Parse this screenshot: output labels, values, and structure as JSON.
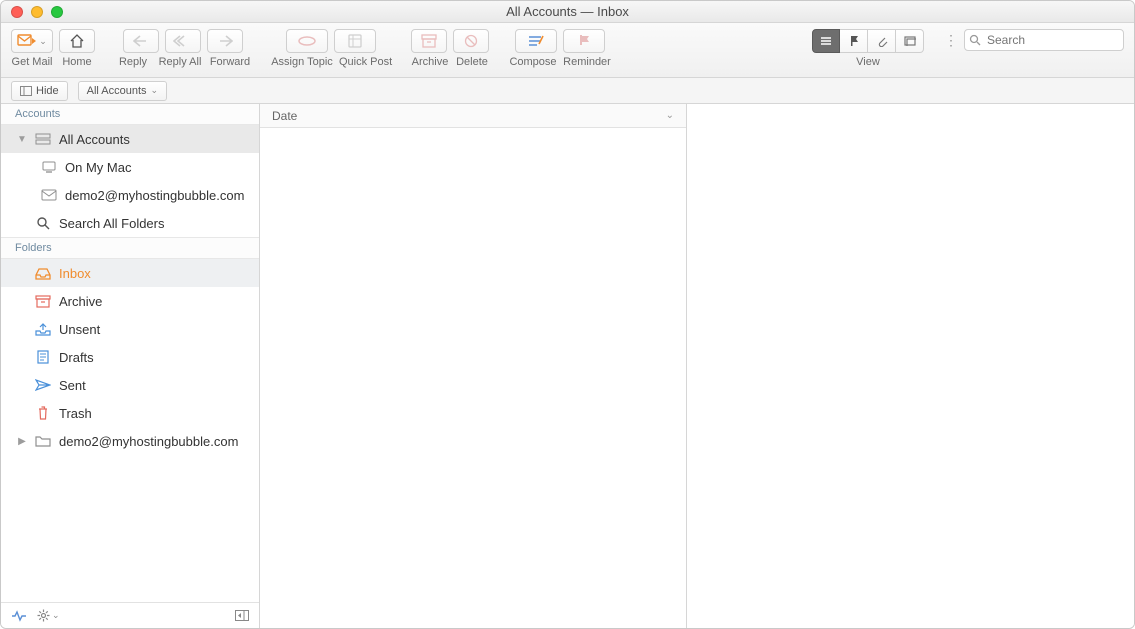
{
  "window": {
    "title": "All Accounts — Inbox"
  },
  "toolbar": {
    "get_mail": "Get Mail",
    "home": "Home",
    "reply": "Reply",
    "reply_all": "Reply All",
    "forward": "Forward",
    "assign_topic": "Assign Topic",
    "quick_post": "Quick Post",
    "archive": "Archive",
    "delete": "Delete",
    "compose": "Compose",
    "reminder": "Reminder",
    "view": "View"
  },
  "subbar": {
    "hide": "Hide",
    "scope": "All Accounts"
  },
  "sidebar": {
    "accounts_header": "Accounts",
    "folders_header": "Folders",
    "accounts": [
      {
        "label": "All Accounts"
      },
      {
        "label": "On My Mac"
      },
      {
        "label": "demo2@myhostingbubble.com"
      }
    ],
    "search_all": "Search All Folders",
    "folders": [
      {
        "label": "Inbox"
      },
      {
        "label": "Archive"
      },
      {
        "label": "Unsent"
      },
      {
        "label": "Drafts"
      },
      {
        "label": "Sent"
      },
      {
        "label": "Trash"
      }
    ],
    "extra_account": "demo2@myhostingbubble.com"
  },
  "list": {
    "date_header": "Date"
  },
  "search": {
    "placeholder": "Search"
  },
  "colors": {
    "orange": "#f08c2e",
    "blue": "#4a90d9",
    "red": "#e46a5e",
    "gray": "#8f8f8f"
  }
}
